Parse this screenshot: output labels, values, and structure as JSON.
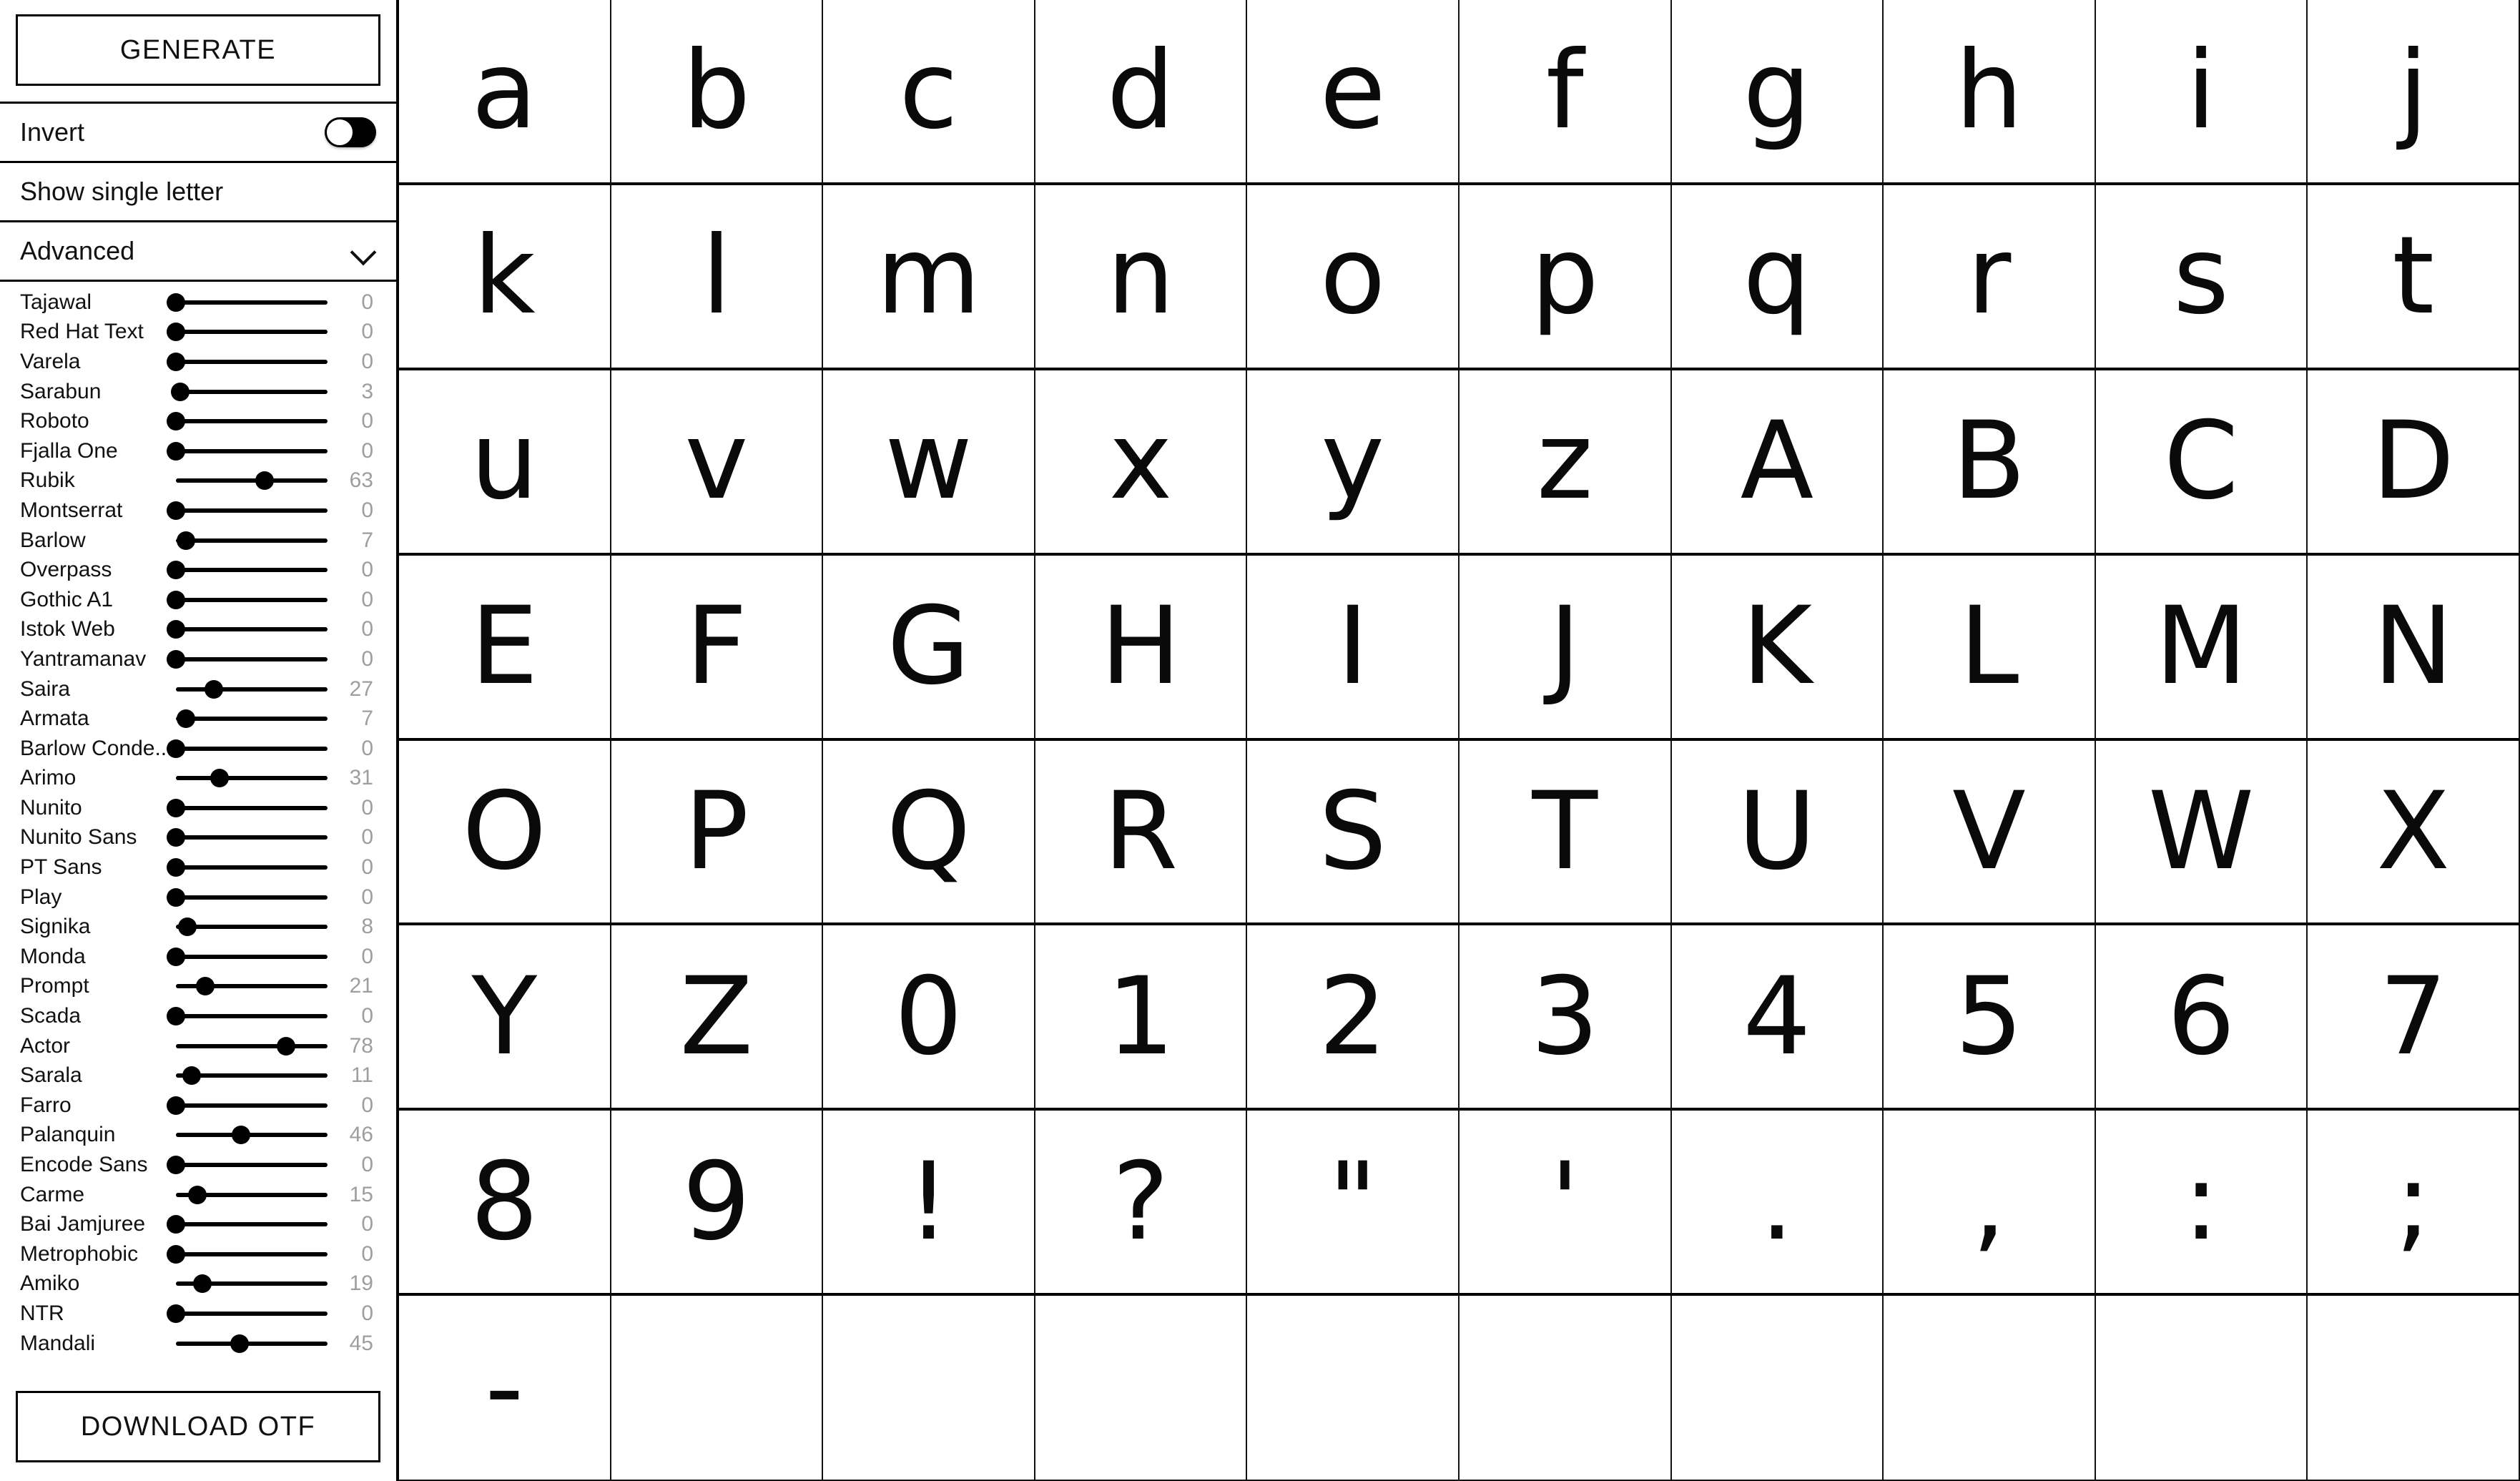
{
  "sidebar": {
    "generate_button": "GENERATE",
    "invert": {
      "label": "Invert",
      "state": "off"
    },
    "show_single_letter": {
      "label": "Show single letter"
    },
    "advanced": {
      "label": "Advanced",
      "chevron": "chevron-down-icon"
    },
    "download_button": "DOWNLOAD OTF",
    "sliders": [
      {
        "name": "Tajawal",
        "value": "0"
      },
      {
        "name": "Red Hat Text",
        "value": "0"
      },
      {
        "name": "Varela",
        "value": "0"
      },
      {
        "name": "Sarabun",
        "value": "3"
      },
      {
        "name": "Roboto",
        "value": "0"
      },
      {
        "name": "Fjalla One",
        "value": "0"
      },
      {
        "name": "Rubik",
        "value": "63"
      },
      {
        "name": "Montserrat",
        "value": "0"
      },
      {
        "name": "Barlow",
        "value": "7"
      },
      {
        "name": "Overpass",
        "value": "0"
      },
      {
        "name": "Gothic A1",
        "value": "0"
      },
      {
        "name": "Istok Web",
        "value": "0"
      },
      {
        "name": "Yantramanav",
        "value": "0"
      },
      {
        "name": "Saira",
        "value": "27"
      },
      {
        "name": "Armata",
        "value": "7"
      },
      {
        "name": "Barlow Conde...",
        "value": "0"
      },
      {
        "name": "Arimo",
        "value": "31"
      },
      {
        "name": "Nunito",
        "value": "0"
      },
      {
        "name": "Nunito Sans",
        "value": "0"
      },
      {
        "name": "PT Sans",
        "value": "0"
      },
      {
        "name": "Play",
        "value": "0"
      },
      {
        "name": "Signika",
        "value": "8"
      },
      {
        "name": "Monda",
        "value": "0"
      },
      {
        "name": "Prompt",
        "value": "21"
      },
      {
        "name": "Scada",
        "value": "0"
      },
      {
        "name": "Actor",
        "value": "78"
      },
      {
        "name": "Sarala",
        "value": "11"
      },
      {
        "name": "Farro",
        "value": "0"
      },
      {
        "name": "Palanquin",
        "value": "46"
      },
      {
        "name": "Encode Sans",
        "value": "0"
      },
      {
        "name": "Carme",
        "value": "15"
      },
      {
        "name": "Bai Jamjuree",
        "value": "0"
      },
      {
        "name": "Metrophobic",
        "value": "0"
      },
      {
        "name": "Amiko",
        "value": "19"
      },
      {
        "name": "NTR",
        "value": "0"
      },
      {
        "name": "Mandali",
        "value": "45"
      }
    ]
  },
  "grid": {
    "columns": 10,
    "rows": 8,
    "glyphs": [
      "a",
      "b",
      "c",
      "d",
      "e",
      "f",
      "g",
      "h",
      "i",
      "j",
      "k",
      "l",
      "m",
      "n",
      "o",
      "p",
      "q",
      "r",
      "s",
      "t",
      "u",
      "v",
      "w",
      "x",
      "y",
      "z",
      "A",
      "B",
      "C",
      "D",
      "E",
      "F",
      "G",
      "H",
      "I",
      "J",
      "K",
      "L",
      "M",
      "N",
      "O",
      "P",
      "Q",
      "R",
      "S",
      "T",
      "U",
      "V",
      "W",
      "X",
      "Y",
      "Z",
      "0",
      "1",
      "2",
      "3",
      "4",
      "5",
      "6",
      "7",
      "8",
      "9",
      "!",
      "?",
      "\"",
      "'",
      ".",
      ",",
      ":",
      ";",
      "-",
      "",
      "",
      "",
      "",
      "",
      "",
      "",
      "",
      ""
    ]
  },
  "colors": {
    "text": "#111111",
    "value_gray": "#9e9e9e",
    "border": "#000000",
    "background": "#ffffff"
  }
}
